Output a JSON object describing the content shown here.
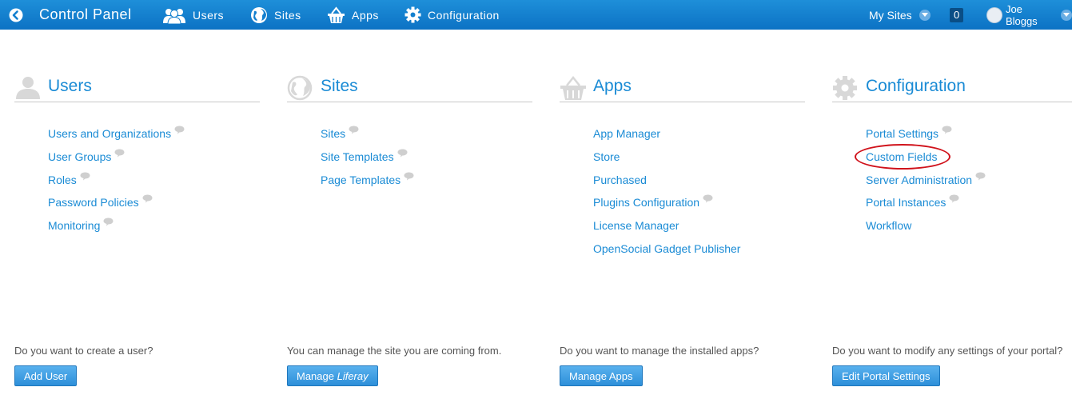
{
  "topbar": {
    "title": "Control Panel",
    "nav": [
      {
        "label": "Users",
        "icon": "users-icon"
      },
      {
        "label": "Sites",
        "icon": "globe-icon"
      },
      {
        "label": "Apps",
        "icon": "basket-icon"
      },
      {
        "label": "Configuration",
        "icon": "gear-icon"
      }
    ],
    "my_sites": "My Sites",
    "notification_count": "0",
    "user_name": "Joe Bloggs"
  },
  "columns": [
    {
      "title": "Users",
      "icon": "users-icon",
      "links": [
        "Users and Organizations",
        "User Groups",
        "Roles",
        "Password Policies",
        "Monitoring"
      ],
      "question": "Do you want to create a user?",
      "button": "Add User"
    },
    {
      "title": "Sites",
      "icon": "globe-icon",
      "links": [
        "Sites",
        "Site Templates",
        "Page Templates"
      ],
      "question": "You can manage the site you are coming from.",
      "button_prefix": "Manage ",
      "button_italic": "Liferay"
    },
    {
      "title": "Apps",
      "icon": "basket-icon",
      "links": [
        "App Manager",
        "Store",
        "Purchased",
        "Plugins Configuration",
        "License Manager",
        "OpenSocial Gadget Publisher"
      ],
      "question": "Do you want to manage the installed apps?",
      "button": "Manage Apps"
    },
    {
      "title": "Configuration",
      "icon": "gear-icon",
      "links": [
        "Portal Settings",
        "Custom Fields",
        "Server Administration",
        "Portal Instances",
        "Workflow"
      ],
      "question": "Do you want to modify any settings of your portal?",
      "button": "Edit Portal Settings"
    }
  ],
  "annotation_color": "#d0121b",
  "accent_color": "#1a8bd5"
}
